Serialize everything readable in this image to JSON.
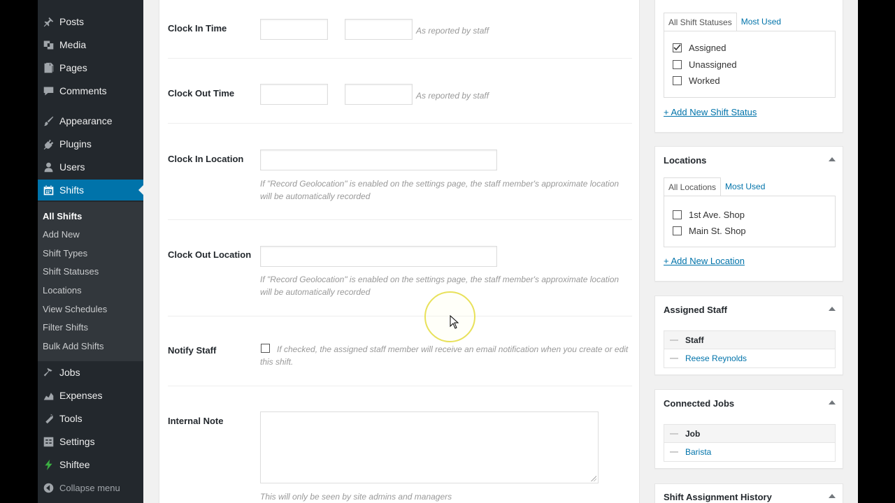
{
  "sidebar": {
    "menu": [
      {
        "label": "Posts",
        "icon": "pin-icon"
      },
      {
        "label": "Media",
        "icon": "media-icon"
      },
      {
        "label": "Pages",
        "icon": "pages-icon"
      },
      {
        "label": "Comments",
        "icon": "comments-icon"
      },
      {
        "label": "Appearance",
        "icon": "brush-icon"
      },
      {
        "label": "Plugins",
        "icon": "plugin-icon"
      },
      {
        "label": "Users",
        "icon": "users-icon"
      },
      {
        "label": "Shifts",
        "icon": "calendar-icon"
      }
    ],
    "submenu": [
      "All Shifts",
      "Add New",
      "Shift Types",
      "Shift Statuses",
      "Locations",
      "View Schedules",
      "Filter Shifts",
      "Bulk Add Shifts"
    ],
    "menu_bottom": [
      {
        "label": "Jobs",
        "icon": "hammer-icon"
      },
      {
        "label": "Expenses",
        "icon": "chart-icon"
      },
      {
        "label": "Tools",
        "icon": "wrench-icon"
      },
      {
        "label": "Settings",
        "icon": "settings-icon"
      },
      {
        "label": "Shiftee",
        "icon": "bolt-icon"
      }
    ],
    "collapse_label": "Collapse menu"
  },
  "form": {
    "clock_in_time": {
      "label": "Clock In Time",
      "hint": "As reported by staff"
    },
    "clock_out_time": {
      "label": "Clock Out Time",
      "hint": "As reported by staff"
    },
    "clock_in_location": {
      "label": "Clock In Location",
      "hint": "If \"Record Geolocation\" is enabled on the settings page, the staff member's approximate location will be automatically recorded"
    },
    "clock_out_location": {
      "label": "Clock Out Location",
      "hint": "If \"Record Geolocation\" is enabled on the settings page, the staff member's approximate location will be automatically recorded"
    },
    "notify_staff": {
      "label": "Notify Staff",
      "hint": "If checked, the assigned staff member will receive an email notification when you create or edit this shift."
    },
    "internal_note": {
      "label": "Internal Note",
      "hint": "This will only be seen by site admins and managers"
    }
  },
  "shift_status_box": {
    "tab_all": "All Shift Statuses",
    "tab_used": "Most Used",
    "options": [
      {
        "label": "Assigned",
        "checked": true
      },
      {
        "label": "Unassigned",
        "checked": false
      },
      {
        "label": "Worked",
        "checked": false
      }
    ],
    "add_link": "+ Add New Shift Status"
  },
  "locations_box": {
    "title": "Locations",
    "tab_all": "All Locations",
    "tab_used": "Most Used",
    "options": [
      {
        "label": "1st Ave. Shop",
        "checked": false
      },
      {
        "label": "Main St. Shop",
        "checked": false
      }
    ],
    "add_link": "+ Add New Location"
  },
  "assigned_staff_box": {
    "title": "Assigned Staff",
    "header": "Staff",
    "value": "Reese Reynolds"
  },
  "connected_jobs_box": {
    "title": "Connected Jobs",
    "header": "Job",
    "value": "Barista"
  },
  "history_box": {
    "title": "Shift Assignment History"
  },
  "colors": {
    "accent": "#0073aa",
    "sidebar": "#23282d",
    "submenu": "#32373c"
  }
}
